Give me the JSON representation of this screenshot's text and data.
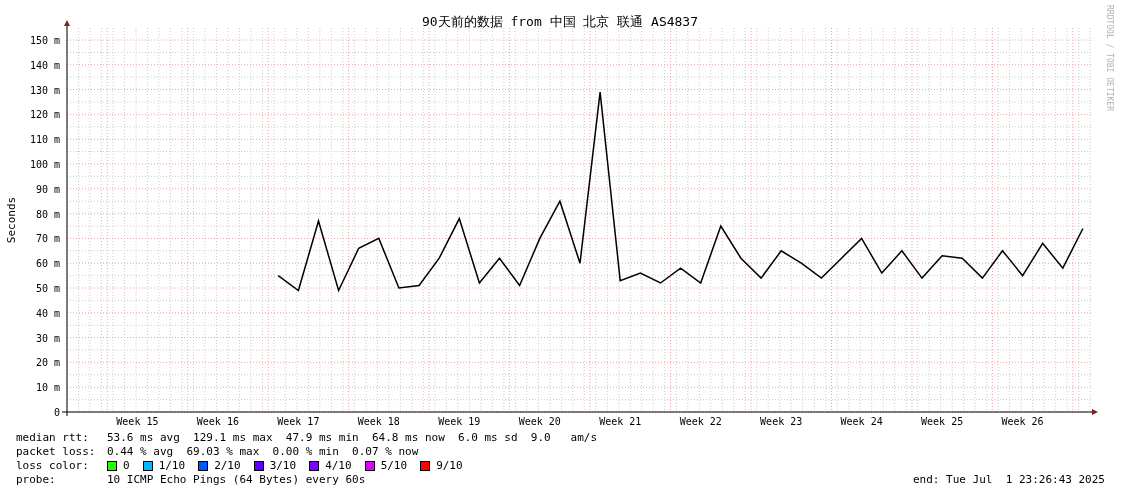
{
  "chart": {
    "credit": "RRDTOOL / TOBI OETIKER",
    "chart_data": {
      "type": "line",
      "title": "90天前的数据 from 中国 北京 联通 AS4837",
      "ylabel": "Seconds",
      "ylim": [
        0,
        150
      ],
      "grid": true,
      "categories": [
        null,
        null,
        null,
        "Week 15",
        null,
        null,
        null,
        "Week 16",
        null,
        null,
        null,
        "Week 17",
        null,
        null,
        null,
        "Week 18",
        null,
        null,
        null,
        "Week 19",
        null,
        null,
        null,
        "Week 20",
        null,
        null,
        null,
        "Week 21",
        null,
        null,
        null,
        "Week 22",
        null,
        null,
        null,
        "Week 23",
        null,
        null,
        null,
        "Week 24",
        null,
        null,
        null,
        "Week 25",
        null,
        null,
        null,
        "Week 26",
        null,
        null,
        null
      ],
      "yticks": [
        {
          "value": 0,
          "label": "0"
        },
        {
          "value": 10,
          "label": "10 m"
        },
        {
          "value": 20,
          "label": "20 m"
        },
        {
          "value": 30,
          "label": "30 m"
        },
        {
          "value": 40,
          "label": "40 m"
        },
        {
          "value": 50,
          "label": "50 m"
        },
        {
          "value": 60,
          "label": "60 m"
        },
        {
          "value": 70,
          "label": "70 m"
        },
        {
          "value": 80,
          "label": "80 m"
        },
        {
          "value": 90,
          "label": "90 m"
        },
        {
          "value": 100,
          "label": "100 m"
        },
        {
          "value": 110,
          "label": "110 m"
        },
        {
          "value": 120,
          "label": "120 m"
        },
        {
          "value": 130,
          "label": "130 m"
        },
        {
          "value": 140,
          "label": "140 m"
        },
        {
          "value": 150,
          "label": "150 m"
        }
      ],
      "series": [
        {
          "color": "#000000",
          "values": [
            null,
            null,
            null,
            null,
            null,
            null,
            null,
            null,
            null,
            null,
            55,
            49,
            77,
            49,
            66,
            70,
            50,
            51,
            62,
            78,
            52,
            62,
            51,
            70,
            85,
            60,
            129,
            53,
            56,
            52,
            58,
            52,
            75,
            62,
            54,
            65,
            60,
            54,
            62,
            70,
            56,
            65,
            54,
            63,
            62,
            54,
            65,
            55,
            68,
            58,
            74
          ]
        }
      ]
    }
  },
  "stats": [
    {
      "label": "median rtt:",
      "value": "53.6 ms avg  129.1 ms max  47.9 ms min  64.8 ms now  6.0 ms sd  9.0   am/s"
    },
    {
      "label": "packet loss:",
      "value": "0.44 % avg  69.03 % max  0.00 % min  0.07 % now"
    }
  ],
  "loss_color": {
    "label": "loss color:",
    "items": [
      {
        "label": "0",
        "color": "#26ff00"
      },
      {
        "label": "1/10",
        "color": "#00b8ff"
      },
      {
        "label": "2/10",
        "color": "#0059ff"
      },
      {
        "label": "3/10",
        "color": "#5e00ff"
      },
      {
        "label": "4/10",
        "color": "#7e00ff"
      },
      {
        "label": "5/10",
        "color": "#dd00ff"
      },
      {
        "label": "9/10",
        "color": "#ff0000"
      }
    ]
  },
  "probe": {
    "label": "probe:",
    "value": "10 ICMP Echo Pings (64 Bytes) every 60s"
  },
  "end": "end: Tue Jul  1 23:26:43 2025"
}
